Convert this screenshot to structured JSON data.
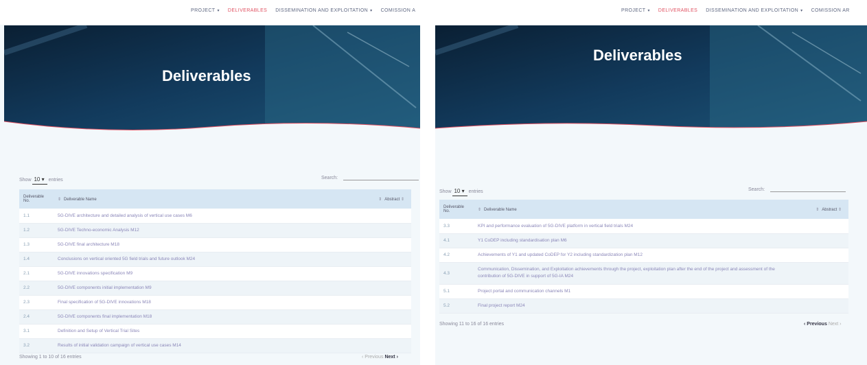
{
  "nav": {
    "items": [
      {
        "label": "PROJECT",
        "caret": "▾"
      },
      {
        "label": "DELIVERABLES",
        "caret": ""
      },
      {
        "label": "DISSEMINATION AND EXPLOITATION",
        "caret": "▾"
      },
      {
        "label": "COMISSION A",
        "caret": ""
      }
    ],
    "items_right": [
      {
        "label": "PROJECT",
        "caret": "▾"
      },
      {
        "label": "DELIVERABLES",
        "caret": ""
      },
      {
        "label": "DISSEMINATION AND EXPLOITATION",
        "caret": "▾"
      },
      {
        "label": "COMISSION AR",
        "caret": ""
      }
    ]
  },
  "hero": {
    "title": "Deliverables"
  },
  "controls": {
    "show_prefix": "Show",
    "page_size": "10",
    "page_size_caret": "▾",
    "show_suffix": "entries",
    "search_label": "Search:"
  },
  "table": {
    "headers": {
      "no": "Deliverable No.",
      "name": "Deliverable Name",
      "abstract": "Abstract"
    },
    "sort_icon": "⇕"
  },
  "left": {
    "rows": [
      {
        "no": "1.1",
        "name": "5G-DIVE architecture and detailed analysis of vertical use cases M6"
      },
      {
        "no": "1.2",
        "name": "5G-DIVE Techno-economic Analysis M12"
      },
      {
        "no": "1.3",
        "name": "5G-DIVE final architecture M18"
      },
      {
        "no": "1.4",
        "name": "Conclusions on vertical oriented 5G field trials and future outlook M24"
      },
      {
        "no": "2.1",
        "name": "5G-DIVE innovations specification M9"
      },
      {
        "no": "2.2",
        "name": "5G-DIVE components initial implementation M9"
      },
      {
        "no": "2.3",
        "name": "Final specification of 5G-DIVE innovations M18"
      },
      {
        "no": "2.4",
        "name": "5G-DIVE components final implementation M18"
      },
      {
        "no": "3.1",
        "name": "Definition and Setup of Vertical Trial Sites"
      },
      {
        "no": "3.2",
        "name": "Results of initial validation campaign of vertical use cases M14"
      }
    ],
    "info": "Showing 1 to 10 of 16 entries",
    "prev": "‹ Previous",
    "next": "Next ›"
  },
  "right": {
    "rows": [
      {
        "no": "3.3",
        "name": "KPI and performance evaluation of 5G-DIVE platform in vertical field trials M24"
      },
      {
        "no": "4.1",
        "name": "Y1 CoDEP including standardisation plan M6"
      },
      {
        "no": "4.2",
        "name": "Achievements of Y1 and updated CoDEP for Y2 including standardization plan M12"
      },
      {
        "no": "4.3",
        "name": "Communication, Dissemination, and Exploitation achievements through the project, exploitation plan after the end of the project and assessment of the contribution of 5G-DIVE in support of 5G-IA M24"
      },
      {
        "no": "5.1",
        "name": "Project portal and communication channels M1"
      },
      {
        "no": "5.2",
        "name": "Final project report M24"
      }
    ],
    "info": "Showing 11 to 16 of 16 entries",
    "prev": "‹ Previous",
    "next": "Next ›"
  },
  "colors": {
    "accent": "#e05060",
    "header_bg": "#d6e6f3",
    "hero": "#0d2a45"
  }
}
